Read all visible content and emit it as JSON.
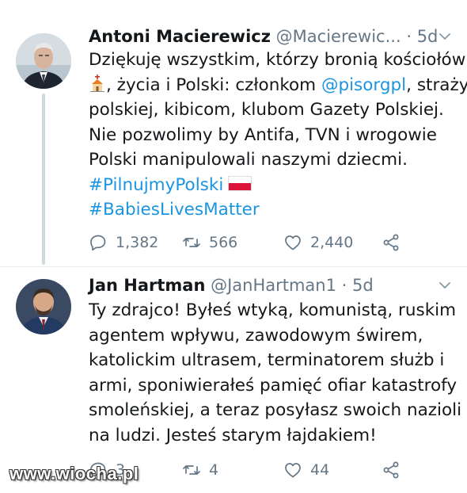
{
  "tweets": [
    {
      "author_name": "Antoni Macierewicz",
      "handle": "@Macierewic...",
      "separator": "·",
      "time": "5d",
      "text": {
        "l1": "Dziękuję wszystkim, którzy bronią kościołów",
        "l2a": ", życia i Polski: członkom ",
        "l2mention": "@pisorgpl",
        "l2b": ", straży",
        "l3": "polskiej, kibicom, klubom Gazety Polskiej.",
        "l4": "Nie pozwolimy by Antifa, TVN i wrogowie",
        "l5": "Polski manipulowali naszymi dziecmi.",
        "hashtag1": "#PilnujmyPolski",
        "hashtag2": "#BabiesLivesMatter"
      },
      "emoji_church": "church-emoji",
      "emoji_flag": "poland-flag-emoji",
      "reply_count": "1,382",
      "retweet_count": "566",
      "like_count": "2,440"
    },
    {
      "author_name": "Jan Hartman",
      "handle": "@JanHartman1",
      "separator": "·",
      "time": "5d",
      "text": {
        "l1": "Ty zdrajco! Byłeś wtyką, komunistą, ruskim",
        "l2": "agentem wpływu, zawodowym świrem,",
        "l3": "katolickim ultrasem, terminatorem służb i",
        "l4": "armi, sponiwierałeś pamięć ofiar katastrofy",
        "l5": "smoleńskiej, a teraz posyłasz swoich nazioli",
        "l6": "na ludzi. Jesteś starym łajdakiem!"
      },
      "reply_count": "3",
      "retweet_count": "4",
      "like_count": "44"
    }
  ],
  "watermark": "www.wiocha.pl",
  "colors": {
    "link": "#1b95e0",
    "secondary_text": "#657786",
    "primary_text": "#14171a",
    "thread_line": "#cfd9de",
    "flag_red": "#dc143c"
  }
}
